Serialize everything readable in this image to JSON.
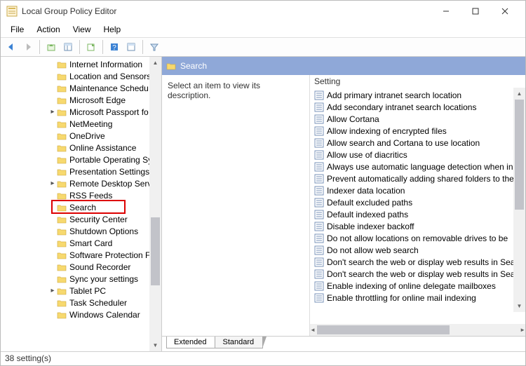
{
  "window": {
    "title": "Local Group Policy Editor"
  },
  "menu": {
    "file": "File",
    "action": "Action",
    "view": "View",
    "help": "Help"
  },
  "tree": {
    "items": [
      {
        "indent": 80,
        "chev": "",
        "label": "Internet Information"
      },
      {
        "indent": 80,
        "chev": "",
        "label": "Location and Sensors"
      },
      {
        "indent": 80,
        "chev": "",
        "label": "Maintenance Schedu"
      },
      {
        "indent": 80,
        "chev": "",
        "label": "Microsoft Edge"
      },
      {
        "indent": 68,
        "chev": ">",
        "label": "Microsoft Passport fo"
      },
      {
        "indent": 80,
        "chev": "",
        "label": "NetMeeting"
      },
      {
        "indent": 80,
        "chev": "",
        "label": "OneDrive"
      },
      {
        "indent": 80,
        "chev": "",
        "label": "Online Assistance"
      },
      {
        "indent": 80,
        "chev": "",
        "label": "Portable Operating Sy"
      },
      {
        "indent": 80,
        "chev": "",
        "label": "Presentation Settings"
      },
      {
        "indent": 68,
        "chev": ">",
        "label": "Remote Desktop Serv"
      },
      {
        "indent": 80,
        "chev": "",
        "label": "RSS Feeds"
      },
      {
        "indent": 80,
        "chev": "",
        "label": "Search",
        "highlighted": true
      },
      {
        "indent": 80,
        "chev": "",
        "label": "Security Center"
      },
      {
        "indent": 80,
        "chev": "",
        "label": "Shutdown Options"
      },
      {
        "indent": 80,
        "chev": "",
        "label": "Smart Card"
      },
      {
        "indent": 80,
        "chev": "",
        "label": "Software Protection F"
      },
      {
        "indent": 80,
        "chev": "",
        "label": "Sound Recorder"
      },
      {
        "indent": 80,
        "chev": "",
        "label": "Sync your settings"
      },
      {
        "indent": 68,
        "chev": ">",
        "label": "Tablet PC"
      },
      {
        "indent": 80,
        "chev": "",
        "label": "Task Scheduler"
      },
      {
        "indent": 80,
        "chev": "",
        "label": "Windows Calendar"
      }
    ]
  },
  "detail": {
    "header": "Search",
    "description": "Select an item to view its description.",
    "setting_header": "Setting",
    "settings": [
      "Add primary intranet search location",
      "Add secondary intranet search locations",
      "Allow Cortana",
      "Allow indexing of encrypted files",
      "Allow search and Cortana to use location",
      "Allow use of diacritics",
      "Always use automatic language detection when in",
      "Prevent automatically adding shared folders to the",
      "Indexer data location",
      "Default excluded paths",
      "Default indexed paths",
      "Disable indexer backoff",
      "Do not allow locations on removable drives to be ",
      "Do not allow web search",
      "Don't search the web or display web results in Sea",
      "Don't search the web or display web results in Sea",
      "Enable indexing of online delegate mailboxes",
      "Enable throttling for online mail indexing"
    ]
  },
  "tabs": {
    "extended": "Extended",
    "standard": "Standard"
  },
  "status": {
    "text": "38 setting(s)"
  }
}
